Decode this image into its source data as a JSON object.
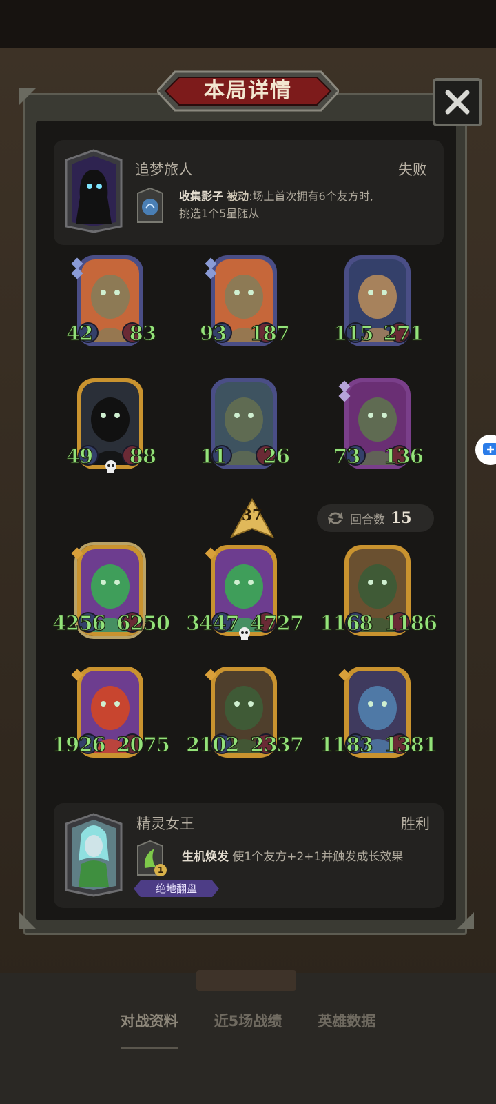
{
  "title": "本局详情",
  "opponent": {
    "name": "追梦旅人",
    "result": "失败",
    "skill_name": "收集影子",
    "skill_type": "被动",
    "skill_desc_line1": ":场上首次拥有6个友方时,",
    "skill_desc_line2": "挑选1个5星随从"
  },
  "opponent_board": [
    {
      "atk": "42",
      "hp": "83"
    },
    {
      "atk": "93",
      "hp": "187"
    },
    {
      "atk": "115",
      "hp": "271"
    },
    {
      "atk": "49",
      "hp": "88"
    },
    {
      "atk": "11",
      "hp": "26"
    },
    {
      "atk": "73",
      "hp": "136"
    }
  ],
  "tier_value": "37",
  "turns": {
    "label": "回合数",
    "value": "15"
  },
  "player_board": [
    {
      "atk": "4256",
      "hp": "6250"
    },
    {
      "atk": "3447",
      "hp": "4727"
    },
    {
      "atk": "1168",
      "hp": "1186"
    },
    {
      "atk": "1926",
      "hp": "2075"
    },
    {
      "atk": "2102",
      "hp": "2337"
    },
    {
      "atk": "1183",
      "hp": "1381"
    }
  ],
  "player": {
    "name": "精灵女王",
    "result": "胜利",
    "skill_name": "生机焕发",
    "skill_desc": "使1个友方+2+1并触发成长效果",
    "skill_cost": "1",
    "tag": "绝地翻盘"
  },
  "bottom_tabs": [
    "对战资料",
    "近5场战绩",
    "英雄数据"
  ],
  "colors": {
    "stat_green": "#93e27a",
    "gold_frame": "#c9932f",
    "blue_frame": "#4a4e86",
    "purple_frame": "#7a3f8a",
    "title_red": "#7d1b1b"
  }
}
